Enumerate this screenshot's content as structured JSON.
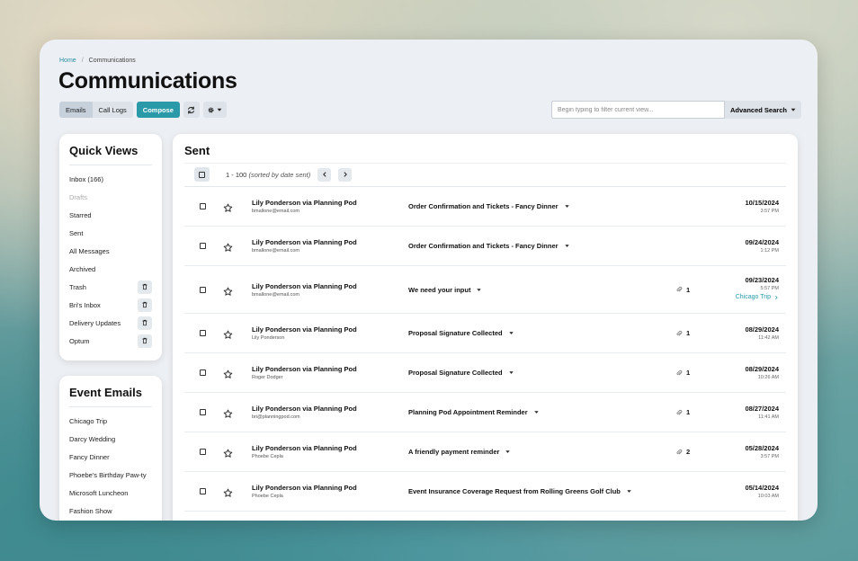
{
  "breadcrumb": {
    "home": "Home",
    "sep": "/",
    "current": "Communications"
  },
  "page_title": "Communications",
  "toolbar": {
    "emails_label": "Emails",
    "call_logs_label": "Call Logs",
    "compose_label": "Compose",
    "refresh_icon": "refresh-icon",
    "settings_icon": "gear-icon"
  },
  "search": {
    "placeholder": "Begin typing to filter current view...",
    "value": "",
    "advanced_label": "Advanced Search"
  },
  "quick_views": {
    "title": "Quick Views",
    "items": [
      {
        "label": "Inbox (166)",
        "muted": false,
        "deletable": false
      },
      {
        "label": "Drafts",
        "muted": true,
        "deletable": false
      },
      {
        "label": "Starred",
        "muted": false,
        "deletable": false
      },
      {
        "label": "Sent",
        "muted": false,
        "deletable": false
      },
      {
        "label": "All Messages",
        "muted": false,
        "deletable": false
      },
      {
        "label": "Archived",
        "muted": false,
        "deletable": false
      },
      {
        "label": "Trash",
        "muted": false,
        "deletable": true
      },
      {
        "label": "Bri's Inbox",
        "muted": false,
        "deletable": true
      },
      {
        "label": "Delivery Updates",
        "muted": false,
        "deletable": true
      },
      {
        "label": "Optum",
        "muted": false,
        "deletable": true
      }
    ]
  },
  "event_emails": {
    "title": "Event Emails",
    "items": [
      "Chicago Trip",
      "Darcy Wedding",
      "Fancy Dinner",
      "Phoebe's Birthday Paw-ty",
      "Microsoft Luncheon",
      "Fashion Show"
    ]
  },
  "main": {
    "title": "Sent",
    "range_text": "1 - 100",
    "range_note": "(sorted by date sent)",
    "rows": [
      {
        "sender": "Lily Ponderson via Planning Pod",
        "sub": "bmallone@email.com",
        "subject": "Order Confirmation and Tickets - Fancy Dinner",
        "attachments": "",
        "date": "10/15/2024",
        "time": "3:57 PM",
        "tag": ""
      },
      {
        "sender": "Lily Ponderson via Planning Pod",
        "sub": "bmallone@email.com",
        "subject": "Order Confirmation and Tickets - Fancy Dinner",
        "attachments": "",
        "date": "09/24/2024",
        "time": "1:12 PM",
        "tag": ""
      },
      {
        "sender": "Lily Ponderson via Planning Pod",
        "sub": "bmallone@email.com",
        "subject": "We need your input",
        "attachments": "1",
        "date": "09/23/2024",
        "time": "5:57 PM",
        "tag": "Chicago Trip"
      },
      {
        "sender": "Lily Ponderson via Planning Pod",
        "sub": "Lily Ponderson",
        "subject": "Proposal Signature Collected",
        "attachments": "1",
        "date": "08/29/2024",
        "time": "11:42 AM",
        "tag": ""
      },
      {
        "sender": "Lily Ponderson via Planning Pod",
        "sub": "Roger Dodger",
        "subject": "Proposal Signature Collected",
        "attachments": "1",
        "date": "08/29/2024",
        "time": "10:26 AM",
        "tag": ""
      },
      {
        "sender": "Lily Ponderson via Planning Pod",
        "sub": "bri@planningpod.com",
        "subject": "Planning Pod Appointment Reminder",
        "attachments": "1",
        "date": "08/27/2024",
        "time": "11:41 AM",
        "tag": ""
      },
      {
        "sender": "Lily Ponderson via Planning Pod",
        "sub": "Phoebe Cepla",
        "subject": "A friendly payment reminder",
        "attachments": "2",
        "date": "05/28/2024",
        "time": "3:57 PM",
        "tag": ""
      },
      {
        "sender": "Lily Ponderson via Planning Pod",
        "sub": "Phoebe Cepla",
        "subject": "Event Insurance Coverage Request from Rolling Greens Golf Club",
        "attachments": "",
        "date": "05/14/2024",
        "time": "10:03 AM",
        "tag": ""
      }
    ]
  },
  "colors": {
    "accent": "#2a9aa8",
    "panel": "#eceff3"
  }
}
